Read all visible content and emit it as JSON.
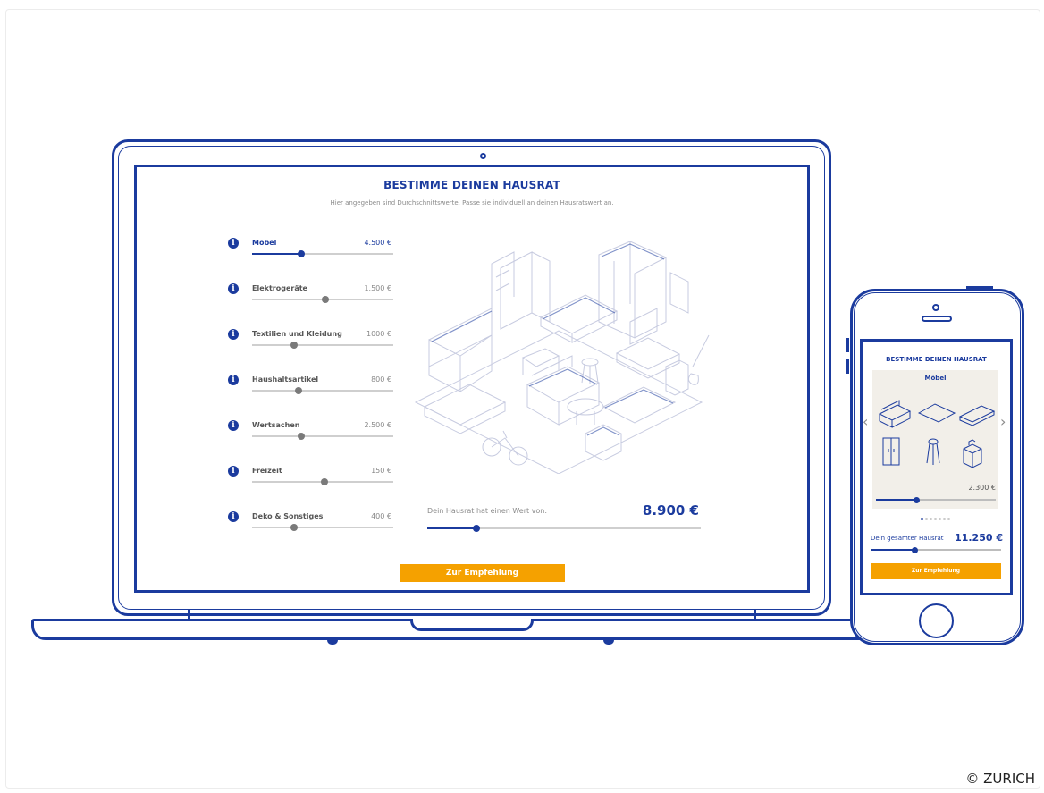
{
  "desktop": {
    "title": "BESTIMME DEINEN HAUSRAT",
    "subtitle": "Hier angegeben sind Durchschnittswerte. Passe sie individuell an deinen Hausratswert an.",
    "info_glyph": "i",
    "categories": [
      {
        "label": "Möbel",
        "value": "4.500 €",
        "level": 0.35,
        "active": true
      },
      {
        "label": "Elektrogeräte",
        "value": "1.500 €",
        "level": 0.52,
        "active": false
      },
      {
        "label": "Textilien und Kleidung",
        "value": "1000 €",
        "level": 0.3,
        "active": false
      },
      {
        "label": "Haushaltsartikel",
        "value": "800 €",
        "level": 0.33,
        "active": false
      },
      {
        "label": "Wertsachen",
        "value": "2.500 €",
        "level": 0.35,
        "active": false
      },
      {
        "label": "Freizeit",
        "value": "150 €",
        "level": 0.51,
        "active": false
      },
      {
        "label": "Deko & Sonstiges",
        "value": "400 €",
        "level": 0.3,
        "active": false
      }
    ],
    "total_label": "Dein Hausrat hat einen Wert von:",
    "total_value": "8.900 €",
    "total_level": 0.18,
    "cta_label": "Zur Empfehlung"
  },
  "mobile": {
    "title": "BESTIMME DEINEN HAUSRAT",
    "card_title": "Möbel",
    "card_value": "2.300 €",
    "card_level": 0.34,
    "prev_glyph": "‹",
    "next_glyph": "›",
    "dots": 7,
    "active_dot": 0,
    "total_label": "Dein gesamter Hausrat",
    "total_value": "11.250 €",
    "total_level": 0.34,
    "cta_label": "Zur Empfehlung"
  },
  "copyright": "© ZURICH",
  "colors": {
    "brand_blue": "#1b3b9e",
    "cta_orange": "#f5a100"
  }
}
